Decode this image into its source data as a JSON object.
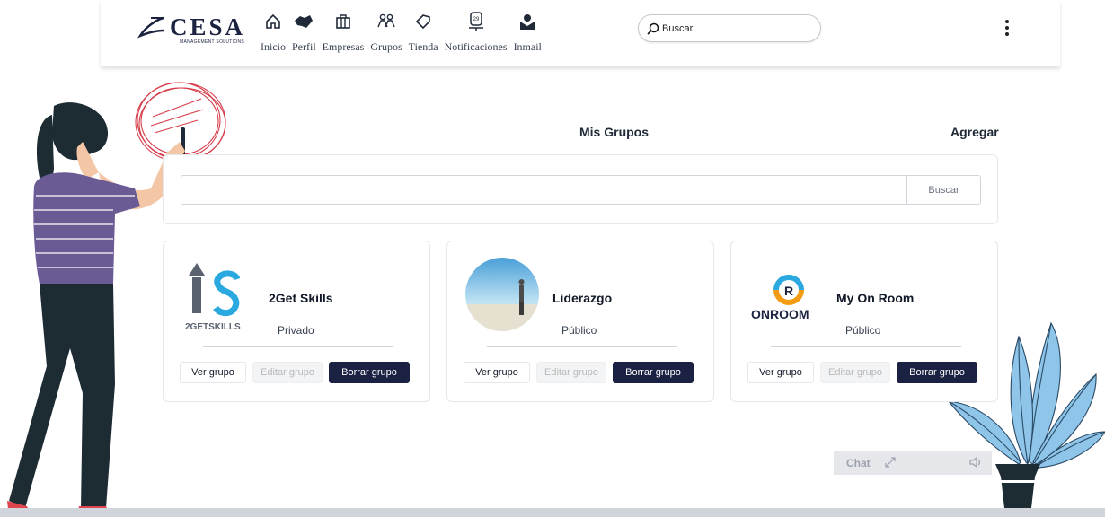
{
  "header": {
    "logo_text": "CESA",
    "logo_subtitle": "MANAGEMENT SOLUTIONS",
    "nav": [
      {
        "label": "Inicio",
        "icon": "home-icon"
      },
      {
        "label": "Perfil",
        "icon": "handshake-icon"
      },
      {
        "label": "Empresas",
        "icon": "briefcase-icon"
      },
      {
        "label": "Grupos",
        "icon": "group-icon"
      },
      {
        "label": "Tienda",
        "icon": "tag-icon"
      },
      {
        "label": "Notificaciones",
        "icon": "notification-icon",
        "badge": "29"
      },
      {
        "label": "Inmail",
        "icon": "inmail-icon"
      }
    ],
    "search_placeholder": "Buscar"
  },
  "main": {
    "title": "Mis Grupos",
    "add_label": "Agregar",
    "search_button": "Buscar",
    "groups": [
      {
        "name": "2Get Skills",
        "privacy": "Privado",
        "logo_text": "2GETSKILLS",
        "view": "Ver grupo",
        "edit": "Editar grupo",
        "delete": "Borrar grupo"
      },
      {
        "name": "Liderazgo",
        "privacy": "Público",
        "view": "Ver grupo",
        "edit": "Editar grupo",
        "delete": "Borrar grupo"
      },
      {
        "name": "My On Room",
        "privacy": "Público",
        "logo_text": "ONROOM",
        "view": "Ver grupo",
        "edit": "Editar grupo",
        "delete": "Borrar grupo"
      }
    ]
  },
  "chat": {
    "label": "Chat"
  },
  "colors": {
    "primary": "#1a2142",
    "accent_blue": "#2aa8e0",
    "accent_orange": "#f39c12"
  }
}
